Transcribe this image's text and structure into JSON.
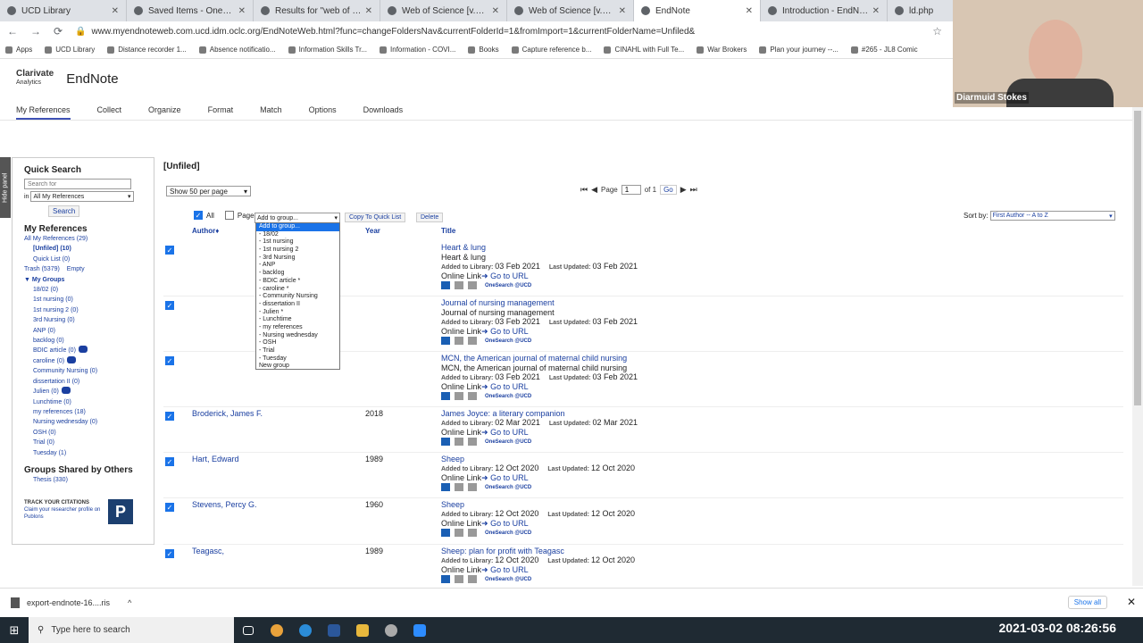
{
  "browser": {
    "tabs": [
      {
        "label": "UCD Library",
        "active": false
      },
      {
        "label": "Saved Items - OneSearch @",
        "active": false
      },
      {
        "label": "Results for \"web of science",
        "active": false
      },
      {
        "label": "Web of Science [v.5.35] - W",
        "active": false
      },
      {
        "label": "Web of Science [v.5.35] - W",
        "active": false
      },
      {
        "label": "EndNote",
        "active": true
      },
      {
        "label": "Introduction - EndNote - Li",
        "active": false
      },
      {
        "label": "ld.php",
        "active": false
      }
    ],
    "url": "www.myendnoteweb.com.ucd.idm.oclc.org/EndNoteWeb.html?func=changeFoldersNav&currentFolderId=1&fromImport=1&currentFolderName=Unfiled&",
    "bookmarks": [
      "Apps",
      "UCD Library",
      "Distance recorder 1...",
      "Absence notificatio...",
      "Information Skills Tr...",
      "Information - COVI...",
      "Books",
      "Capture reference b...",
      "CINAHL with Full Te...",
      "War Brokers",
      "Plan your journey --...",
      "#265 - JL8 Comic"
    ]
  },
  "webcam": {
    "name": "Diarmuid Stokes"
  },
  "app": {
    "brand_top": "Clarivate",
    "brand_bottom": "Analytics",
    "title": "EndNote",
    "menu": [
      "My References",
      "Collect",
      "Organize",
      "Format",
      "Match",
      "Options",
      "Downloads"
    ]
  },
  "sidebar": {
    "hide_panel": "Hide panel",
    "quick_search_title": "Quick Search",
    "search_placeholder": "Search for",
    "in_label": "in",
    "in_select": "All My References",
    "search_button": "Search",
    "my_references_title": "My References",
    "all_refs": "All My References (29)",
    "unfiled": "[Unfiled] (10)",
    "quick_list": "Quick List (0)",
    "trash": "Trash (5379)",
    "empty": "Empty",
    "my_groups": "My Groups",
    "groups": [
      {
        "name": "18/02",
        "count": "(0)",
        "shared": false
      },
      {
        "name": "1st nursing",
        "count": "(0)",
        "shared": false
      },
      {
        "name": "1st nursing 2",
        "count": "(0)",
        "shared": false
      },
      {
        "name": "3rd Nursing",
        "count": "(0)",
        "shared": false
      },
      {
        "name": "ANP",
        "count": "(0)",
        "shared": false
      },
      {
        "name": "backlog",
        "count": "(0)",
        "shared": false
      },
      {
        "name": "BDIC article",
        "count": "(0)",
        "shared": true
      },
      {
        "name": "caroline",
        "count": "(0)",
        "shared": true
      },
      {
        "name": "Community Nursing",
        "count": "(0)",
        "shared": false
      },
      {
        "name": "dissertation II",
        "count": "(0)",
        "shared": false
      },
      {
        "name": "Julien",
        "count": "(0)",
        "shared": true
      },
      {
        "name": "Lunchtime",
        "count": "(0)",
        "shared": false
      },
      {
        "name": "my references",
        "count": "(18)",
        "shared": false
      },
      {
        "name": "Nursing wednesday",
        "count": "(0)",
        "shared": false
      },
      {
        "name": "OSH",
        "count": "(0)",
        "shared": false
      },
      {
        "name": "Trial",
        "count": "(0)",
        "shared": false
      },
      {
        "name": "Tuesday",
        "count": "(1)",
        "shared": false
      }
    ],
    "shared_title": "Groups Shared by Others",
    "shared_items": [
      "Thesis (330)"
    ],
    "publons_bold": "TRACK YOUR CITATIONS",
    "publons_text": "Claim your researcher profile on Publons",
    "publons_logo": "P"
  },
  "main": {
    "folder_title": "[Unfiled]",
    "per_page": "Show 50 per page",
    "page_label": "Page",
    "page_value": "1",
    "of_label": "of 1",
    "go": "Go",
    "all_label": "All",
    "page_cb_label": "Page",
    "add_group": "Add to group...",
    "copy_quick": "Copy To Quick List",
    "delete": "Delete",
    "sort_label": "Sort by:",
    "sort_value": "First Author -- A to Z",
    "col_author": "Author",
    "col_year": "Year",
    "col_title": "Title",
    "added_label": "Added to Library:",
    "updated_label": "Last Updated:",
    "online_label": "Online Link",
    "go_url": "Go to URL",
    "onesearch": "OneSearch @UCD",
    "refs": [
      {
        "author": "",
        "year": "",
        "title": "Heart & lung",
        "journal": "Heart & lung",
        "added": "03 Feb 2021",
        "updated": "03 Feb 2021"
      },
      {
        "author": "",
        "year": "",
        "title": "Journal of nursing management",
        "journal": "Journal of nursing management",
        "added": "03 Feb 2021",
        "updated": "03 Feb 2021"
      },
      {
        "author": "",
        "year": "",
        "title": "MCN, the American journal of maternal child nursing",
        "journal": "MCN, the American journal of maternal child nursing",
        "added": "03 Feb 2021",
        "updated": "03 Feb 2021"
      },
      {
        "author": "Broderick, James F.",
        "year": "2018",
        "title": "James Joyce: a literary companion",
        "journal": "",
        "added": "02 Mar 2021",
        "updated": "02 Mar 2021"
      },
      {
        "author": "Hart, Edward",
        "year": "1989",
        "title": "Sheep",
        "journal": "",
        "added": "12 Oct 2020",
        "updated": "12 Oct 2020"
      },
      {
        "author": "Stevens, Percy G.",
        "year": "1960",
        "title": "Sheep",
        "journal": "",
        "added": "12 Oct 2020",
        "updated": "12 Oct 2020"
      },
      {
        "author": "Teagasc,",
        "year": "1989",
        "title": "Sheep: plan for profit with Teagasc",
        "journal": "",
        "added": "12 Oct 2020",
        "updated": "12 Oct 2020"
      }
    ],
    "dropdown_options": [
      "Add to group...",
      "- 18/02",
      "- 1st nursing",
      "- 1st nursing 2",
      "- 3rd Nursing",
      "- ANP",
      "- backlog",
      "- BDIC article *",
      "- caroline *",
      "- Community Nursing",
      "- dissertation II",
      "- Julien *",
      "- Lunchtime",
      "- my references",
      "- Nursing wednesday",
      "- OSH",
      "- Trial",
      "- Tuesday",
      "New group"
    ]
  },
  "downloads": {
    "file": "export-endnote-16....ris",
    "show_all": "Show all"
  },
  "taskbar": {
    "search": "Type here to search",
    "clock": "2021-03-02  08:26:56"
  }
}
